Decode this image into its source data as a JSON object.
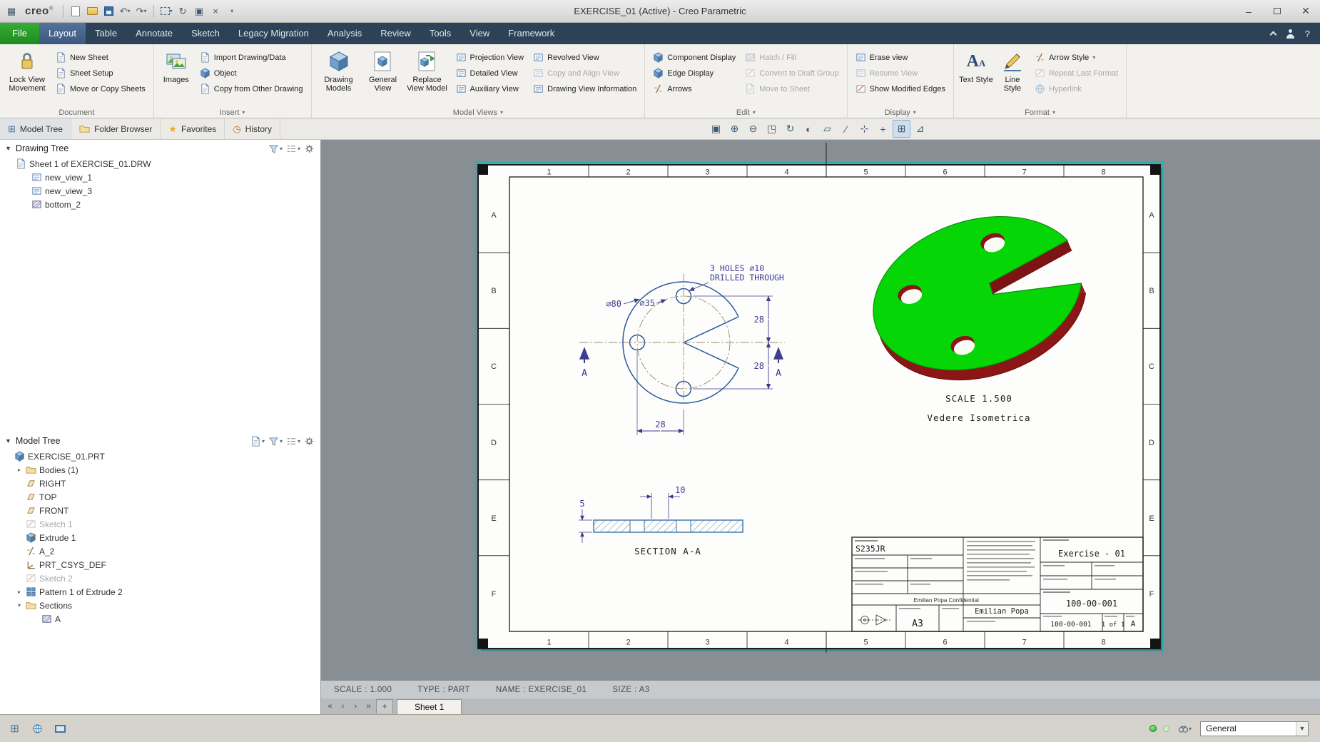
{
  "window": {
    "logo": "creo",
    "title": "EXERCISE_01 (Active) - Creo Parametric"
  },
  "quick": {
    "icons": [
      "menu-grid",
      "new-file",
      "open-file",
      "save",
      "undo",
      "redo",
      "select-box",
      "regenerate",
      "window-cascade",
      "close-window",
      "customize-toolbar"
    ]
  },
  "tabs": {
    "items": [
      "File",
      "Layout",
      "Table",
      "Annotate",
      "Sketch",
      "Legacy Migration",
      "Analysis",
      "Review",
      "Tools",
      "View",
      "Framework"
    ],
    "active": "Layout"
  },
  "ribbon": {
    "document": {
      "label": "Document",
      "big": "Lock View Movement",
      "items": [
        "New Sheet",
        "Sheet Setup",
        "Move or Copy Sheets"
      ]
    },
    "insert": {
      "label": "Insert",
      "big": "Images",
      "items": [
        "Import Drawing/Data",
        "Object",
        "Copy from Other Drawing"
      ]
    },
    "model_views": {
      "label": "Model Views",
      "bigs": [
        "Drawing Models",
        "General View",
        "Replace View Model"
      ],
      "col1": [
        "Projection View",
        "Detailed View",
        "Auxiliary View"
      ],
      "col2": [
        "Revolved View",
        "Copy and Align View",
        "Drawing View Information"
      ]
    },
    "edit": {
      "label": "Edit",
      "col1": [
        "Component Display",
        "Edge Display",
        "Arrows"
      ],
      "col2": [
        "Hatch / Fill",
        "Convert to Draft Group",
        "Move to Sheet"
      ]
    },
    "display": {
      "label": "Display",
      "items": [
        "Erase view",
        "Resume View",
        "Show Modified Edges"
      ]
    },
    "format": {
      "label": "Format",
      "bigs": [
        "Text Style",
        "Line Style"
      ],
      "items": [
        "Arrow Style",
        "Repeat Last Format",
        "Hyperlink"
      ]
    }
  },
  "panel": {
    "tabs": [
      "Model Tree",
      "Folder Browser",
      "Favorites",
      "History"
    ],
    "drawing_tree": {
      "title": "Drawing Tree",
      "root": "Sheet 1 of EXERCISE_01.DRW",
      "children": [
        "new_view_1",
        "new_view_3",
        "bottom_2"
      ]
    },
    "model_tree": {
      "title": "Model Tree",
      "items": [
        "EXERCISE_01.PRT",
        "Bodies (1)",
        "RIGHT",
        "TOP",
        "FRONT",
        "Sketch 1",
        "Extrude 1",
        "A_2",
        "PRT_CSYS_DEF",
        "Sketch 2",
        "Pattern 1 of Extrude 2",
        "Sections",
        "A"
      ]
    }
  },
  "minitoolbar": {
    "icons": [
      "zoom-box",
      "zoom-in",
      "zoom-out",
      "refit",
      "repaint",
      "display-style",
      "plane-display",
      "axis-display",
      "point-display",
      "csys-display",
      "annotation-display",
      "spin-center"
    ],
    "glyphs": [
      "▣",
      "⊕",
      "⊖",
      "◳",
      "↻",
      "◐",
      "▱",
      "∕",
      "⊹",
      "+",
      "⊞",
      "⊿"
    ]
  },
  "drawing": {
    "zones_h": [
      "1",
      "2",
      "3",
      "4",
      "5",
      "6",
      "7",
      "8"
    ],
    "zones_v": [
      "A",
      "B",
      "C",
      "D",
      "E",
      "F"
    ],
    "note1": "3 HOLES ⌀10",
    "note2": "DRILLED THROUGH",
    "d80": "⌀80",
    "d35": "⌀35",
    "dim28": "28",
    "dim10": "10",
    "dim5": "5",
    "sec": "A",
    "section_title": "SECTION A-A",
    "iso_scale": "SCALE 1.500",
    "iso_name": "Vedere Isometrica",
    "titleblock": {
      "material": "S235JR",
      "description": "Exercise - 01",
      "confidential": "Emilian Popa Confidential",
      "company": "Emilian Popa",
      "sheet_size": "A3",
      "part_no": "100-00-001",
      "dwg_no": "100-00-001",
      "sheet": "1 of 1",
      "rev": "A"
    }
  },
  "statusline": {
    "scale": "SCALE : 1.000",
    "type": "TYPE : PART",
    "name": "NAME : EXERCISE_01",
    "size": "SIZE : A3"
  },
  "sheetbar": {
    "tab": "Sheet 1"
  },
  "statusbar": {
    "filter_label": "General"
  }
}
